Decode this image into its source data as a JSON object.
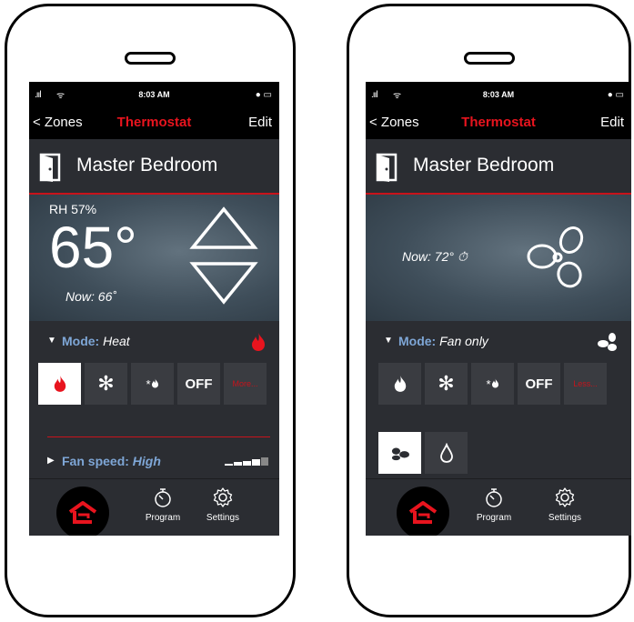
{
  "status": {
    "time": "8:03 AM",
    "signal": ".ııl",
    "wifi": "ᯤ",
    "battery": "● ▭"
  },
  "nav": {
    "back_label": "< Zones",
    "title": "Thermostat",
    "edit_label": "Edit"
  },
  "zone": {
    "name": "Master Bedroom"
  },
  "left": {
    "rh": "RH 57%",
    "setpoint": "65°",
    "now": "Now: 66˚",
    "mode_key": "Mode:",
    "mode_value": "Heat",
    "buttons": {
      "off": "OFF",
      "more": "More..."
    },
    "fan_key": "Fan speed:",
    "fan_value": "High"
  },
  "right": {
    "now": "Now: 72° ⏱",
    "mode_key": "Mode:",
    "mode_value": "Fan only",
    "buttons": {
      "off": "OFF",
      "less": "Less..."
    }
  },
  "tabs": {
    "program": "Program",
    "settings": "Settings"
  },
  "colors": {
    "accent": "#e8141e",
    "mode_key": "#7ea6d6",
    "panel": "#2b2d32",
    "button": "#3a3c41"
  },
  "caret": "▼",
  "caret_right": "▶",
  "snowflake": "✻",
  "snow_flame": "*⁑"
}
